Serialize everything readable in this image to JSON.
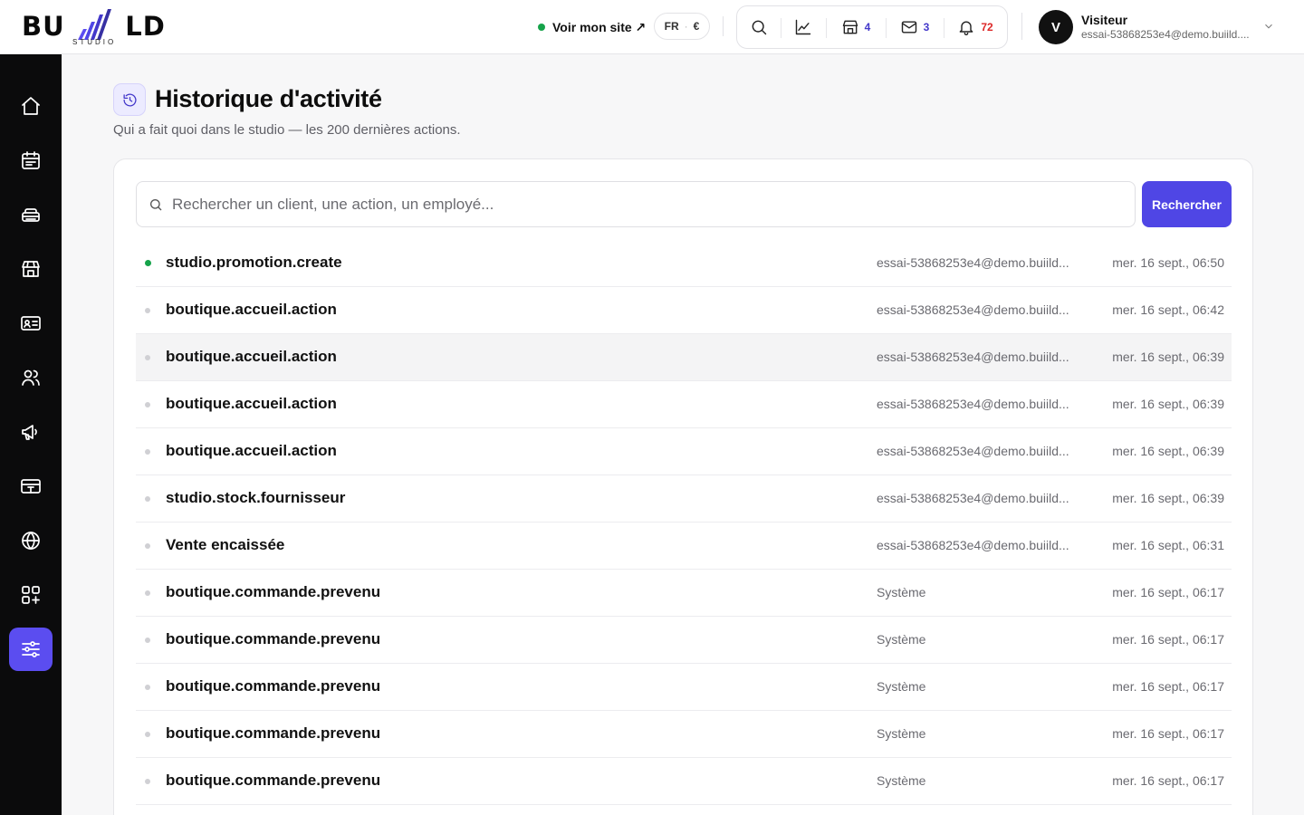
{
  "brand": {
    "name": "BU LD",
    "sub": "STUDIO"
  },
  "header": {
    "site_link": "Voir mon site ↗",
    "lang": "FR",
    "currency": "€",
    "tools": [
      {
        "icon": "search-icon",
        "count": ""
      },
      {
        "icon": "chart-icon",
        "count": ""
      },
      {
        "icon": "store-icon",
        "count": "4"
      },
      {
        "icon": "mail-icon",
        "count": "3"
      },
      {
        "icon": "bell-icon",
        "count": "72"
      }
    ],
    "user": {
      "initial": "V",
      "name": "Visiteur",
      "email": "essai-53868253e4@demo.buiild...."
    }
  },
  "sidebar": {
    "items": [
      {
        "icon": "home-icon",
        "active": false
      },
      {
        "icon": "calendar-icon",
        "active": false
      },
      {
        "icon": "equipment-icon",
        "active": false
      },
      {
        "icon": "store-icon",
        "active": false
      },
      {
        "icon": "id-card-icon",
        "active": false
      },
      {
        "icon": "users-icon",
        "active": false
      },
      {
        "icon": "megaphone-icon",
        "active": false
      },
      {
        "icon": "payment-card-icon",
        "active": false
      },
      {
        "icon": "globe-icon",
        "active": false
      },
      {
        "icon": "apps-add-icon",
        "active": false
      },
      {
        "icon": "sliders-icon",
        "active": true
      }
    ]
  },
  "page": {
    "title": "Historique d'activité",
    "subtitle": "Qui a fait quoi dans le studio — les 200 dernières actions."
  },
  "search": {
    "placeholder": "Rechercher un client, une action, un employé...",
    "value": "",
    "button": "Rechercher"
  },
  "activity": [
    {
      "action": "studio.promotion.create",
      "actor": "essai-53868253e4@demo.buiild...",
      "date": "mer. 16 sept., 06:50",
      "status": "recent"
    },
    {
      "action": "boutique.accueil.action",
      "actor": "essai-53868253e4@demo.buiild...",
      "date": "mer. 16 sept., 06:42",
      "status": ""
    },
    {
      "action": "boutique.accueil.action",
      "actor": "essai-53868253e4@demo.buiild...",
      "date": "mer. 16 sept., 06:39",
      "status": "hover"
    },
    {
      "action": "boutique.accueil.action",
      "actor": "essai-53868253e4@demo.buiild...",
      "date": "mer. 16 sept., 06:39",
      "status": ""
    },
    {
      "action": "boutique.accueil.action",
      "actor": "essai-53868253e4@demo.buiild...",
      "date": "mer. 16 sept., 06:39",
      "status": ""
    },
    {
      "action": "studio.stock.fournisseur",
      "actor": "essai-53868253e4@demo.buiild...",
      "date": "mer. 16 sept., 06:39",
      "status": ""
    },
    {
      "action": "Vente encaissée",
      "actor": "essai-53868253e4@demo.buiild...",
      "date": "mer. 16 sept., 06:31",
      "status": ""
    },
    {
      "action": "boutique.commande.prevenu",
      "actor": "Système",
      "date": "mer. 16 sept., 06:17",
      "status": ""
    },
    {
      "action": "boutique.commande.prevenu",
      "actor": "Système",
      "date": "mer. 16 sept., 06:17",
      "status": ""
    },
    {
      "action": "boutique.commande.prevenu",
      "actor": "Système",
      "date": "mer. 16 sept., 06:17",
      "status": ""
    },
    {
      "action": "boutique.commande.prevenu",
      "actor": "Système",
      "date": "mer. 16 sept., 06:17",
      "status": ""
    },
    {
      "action": "boutique.commande.prevenu",
      "actor": "Système",
      "date": "mer. 16 sept., 06:17",
      "status": ""
    }
  ],
  "colors": {
    "accent": "#4f46e5",
    "active_nav": "#5b4df0",
    "online": "#16a34a",
    "alert": "#dc2626"
  }
}
